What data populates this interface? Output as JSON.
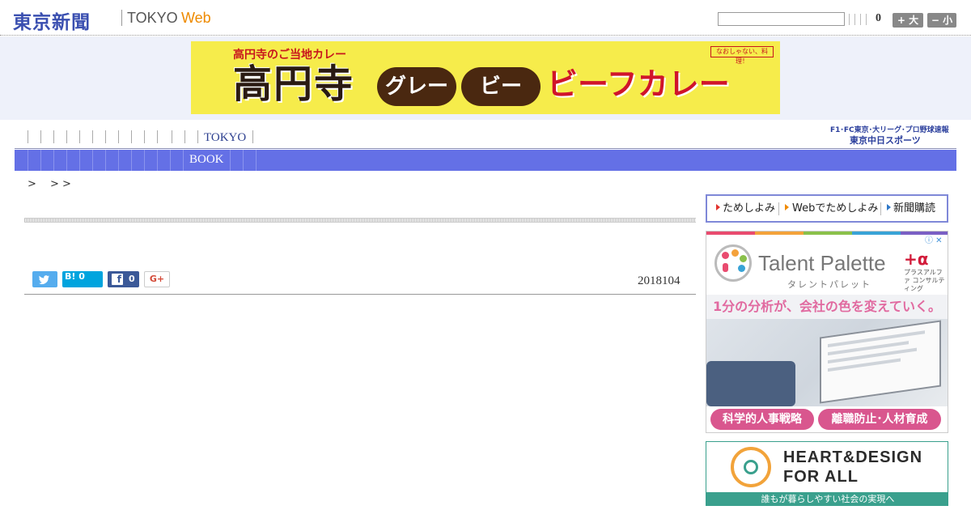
{
  "header": {
    "logo": "東京新聞",
    "site_tokyo": "TOKYO",
    "site_web": "Web",
    "count": "0",
    "font_larger": "+ 大",
    "font_smaller": "− 小",
    "search_placeholder": ""
  },
  "banner_ad": {
    "subtitle": "高円寺のご当地カレー",
    "kanji": "高円寺",
    "pill1": "グレー",
    "pill2": "ビー",
    "curry": "ビーフカレー",
    "corner": "なおしゃない、料理！"
  },
  "nav_primary": {
    "tokyo": "TOKYO"
  },
  "chunichi": {
    "top": "F1･FC東京･大リーグ･プロ野球速報",
    "logo": "東京中日スポーツ"
  },
  "nav_secondary": {
    "book": "BOOK"
  },
  "breadcrumb": ">　 > >",
  "article": {
    "date": "2018104",
    "share": {
      "hatena": "B! 0",
      "facebook_count": "0",
      "google": "G+"
    }
  },
  "subscribe": {
    "trial": "ためしよみ",
    "web_trial": "Webでためしよみ",
    "subscribe": "新聞購読"
  },
  "sidebar_ad_talent": {
    "title": "Talent Palette",
    "kana": "タレントパレット",
    "alpha": "+α",
    "alpha_sub": "プラスアルファ コンサルティング",
    "headline": "1分の分析が、会社の色を変えていく。",
    "pill1": "科学的人事戦略",
    "pill2": "離職防止･人材育成"
  },
  "sidebar_ad_heart": {
    "line1": "HEART&DESIGN",
    "line2": "FOR ALL",
    "foot": "誰もが暮らしやすい社会の実現へ"
  },
  "colors": {
    "nav_blue": "#6470e6",
    "logo_blue": "#3a4fb0",
    "web_orange": "#ee8a00",
    "twitter": "#55acee",
    "hatena": "#00a4de",
    "facebook": "#3b5998"
  }
}
